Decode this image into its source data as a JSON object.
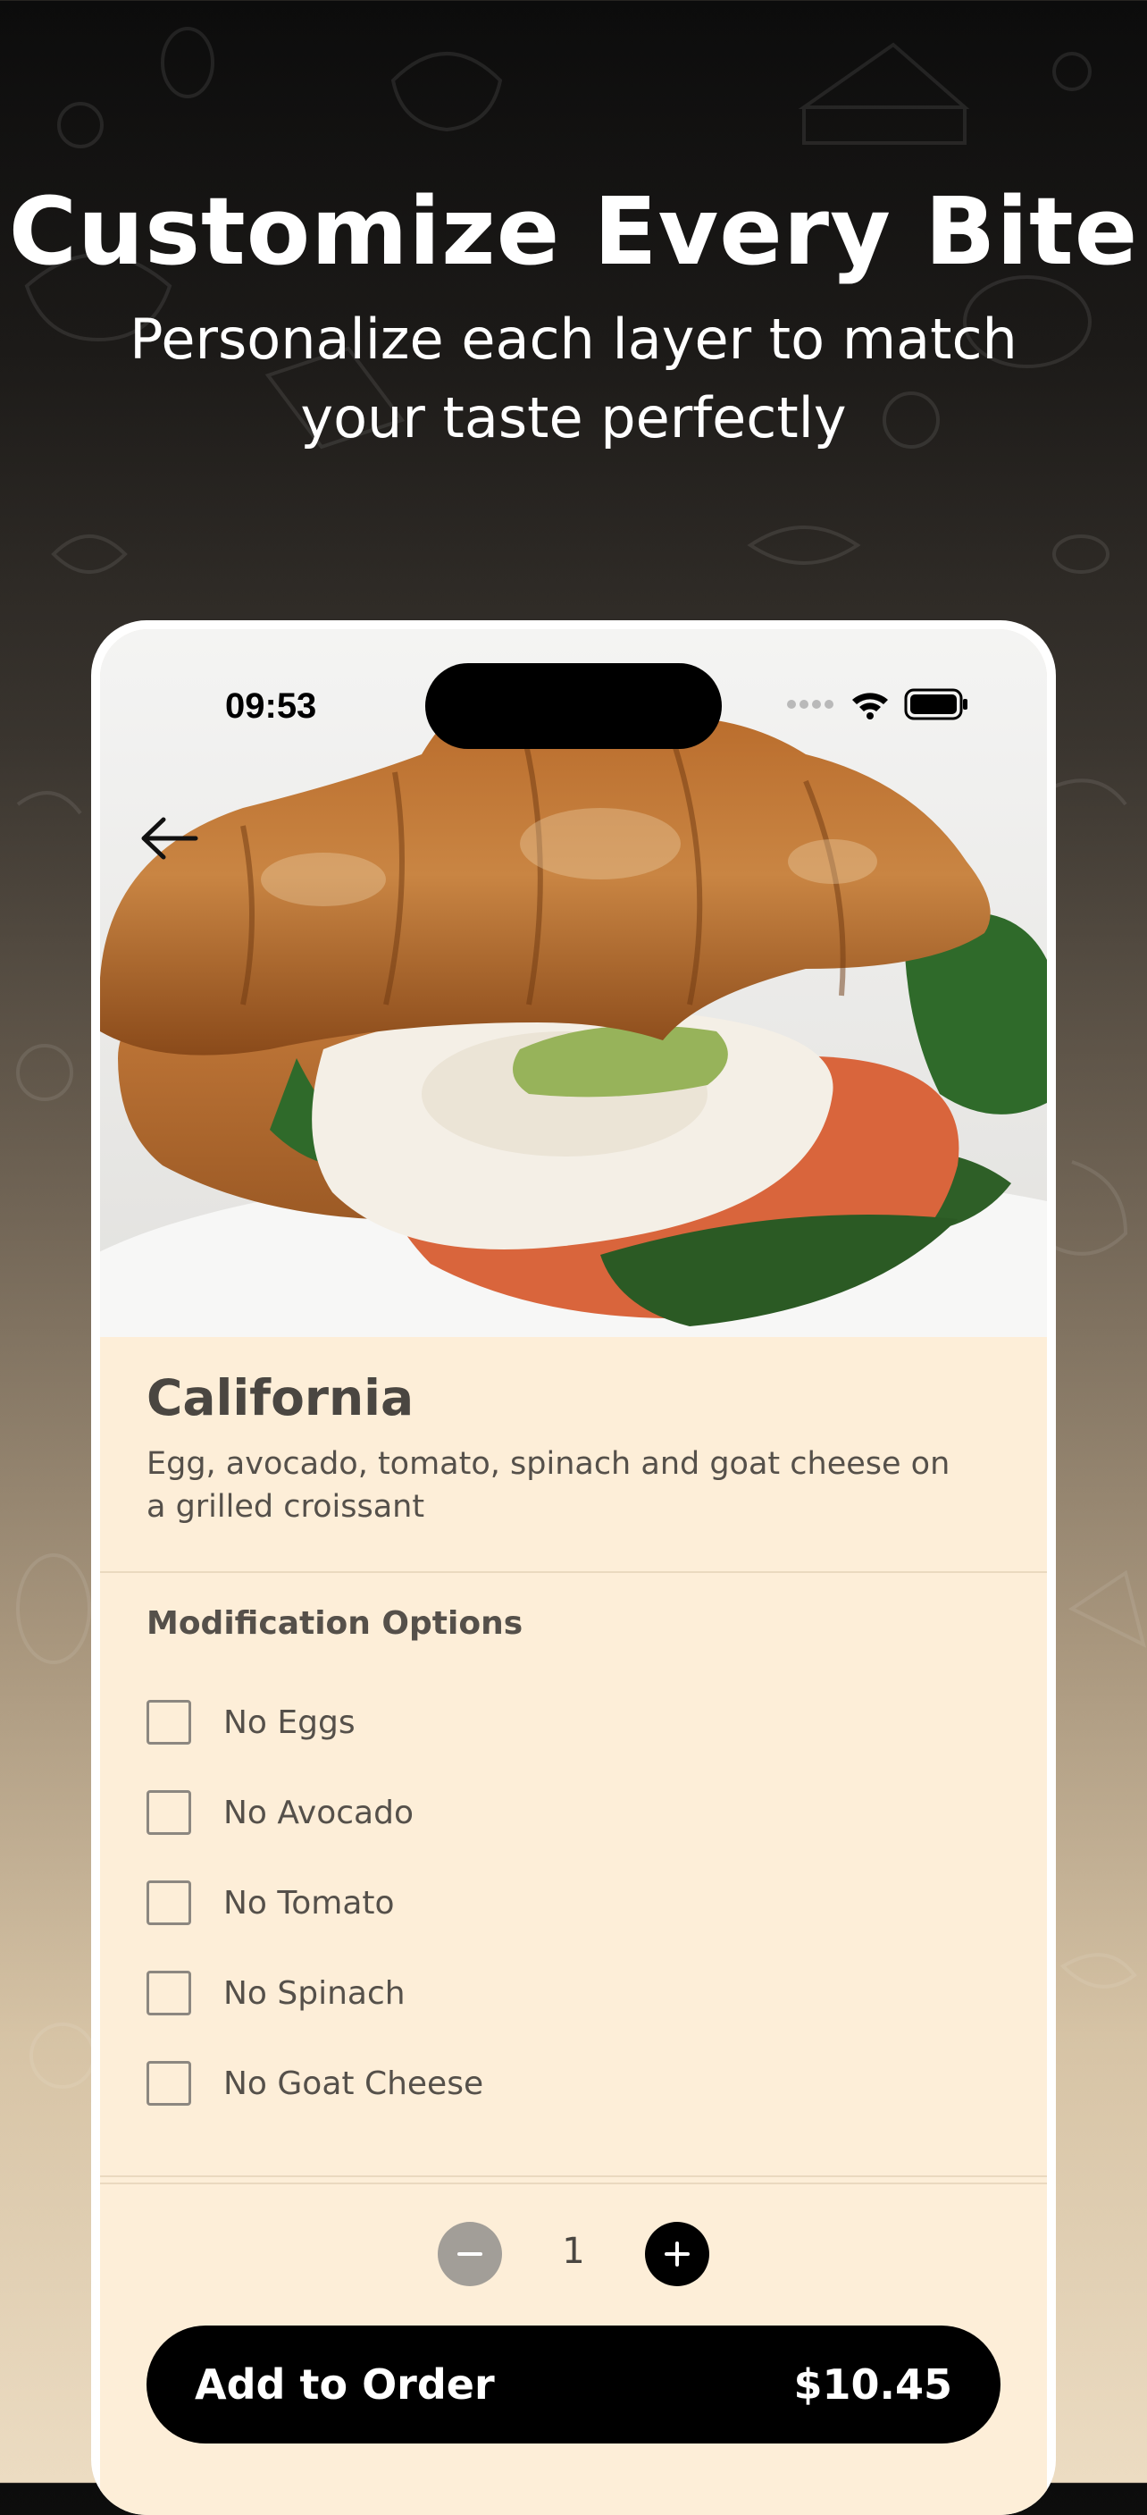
{
  "promo": {
    "headline": "Customize Every Bite",
    "subline": "Personalize each layer to match your taste perfectly"
  },
  "status_bar": {
    "time": "09:53",
    "icons": [
      "cellular-icon",
      "wifi-icon",
      "battery-icon"
    ]
  },
  "product": {
    "image": "croissant-sandwich-photo",
    "name": "California",
    "description": "Egg, avocado, tomato, spinach and goat cheese on a grilled croissant"
  },
  "modifications": {
    "title": "Modification Options",
    "options": [
      {
        "label": "No Eggs",
        "checked": false
      },
      {
        "label": "No Avocado",
        "checked": false
      },
      {
        "label": "No Tomato",
        "checked": false
      },
      {
        "label": "No Spinach",
        "checked": false
      },
      {
        "label": "No Goat Cheese",
        "checked": false
      }
    ]
  },
  "quantity": {
    "value": "1"
  },
  "order_button": {
    "label": "Add to Order",
    "price": "$10.45"
  },
  "colors": {
    "screen_background": "#fdeed8",
    "button": "#000000",
    "text": "#4a4641",
    "minus_button": "#a29e98"
  }
}
